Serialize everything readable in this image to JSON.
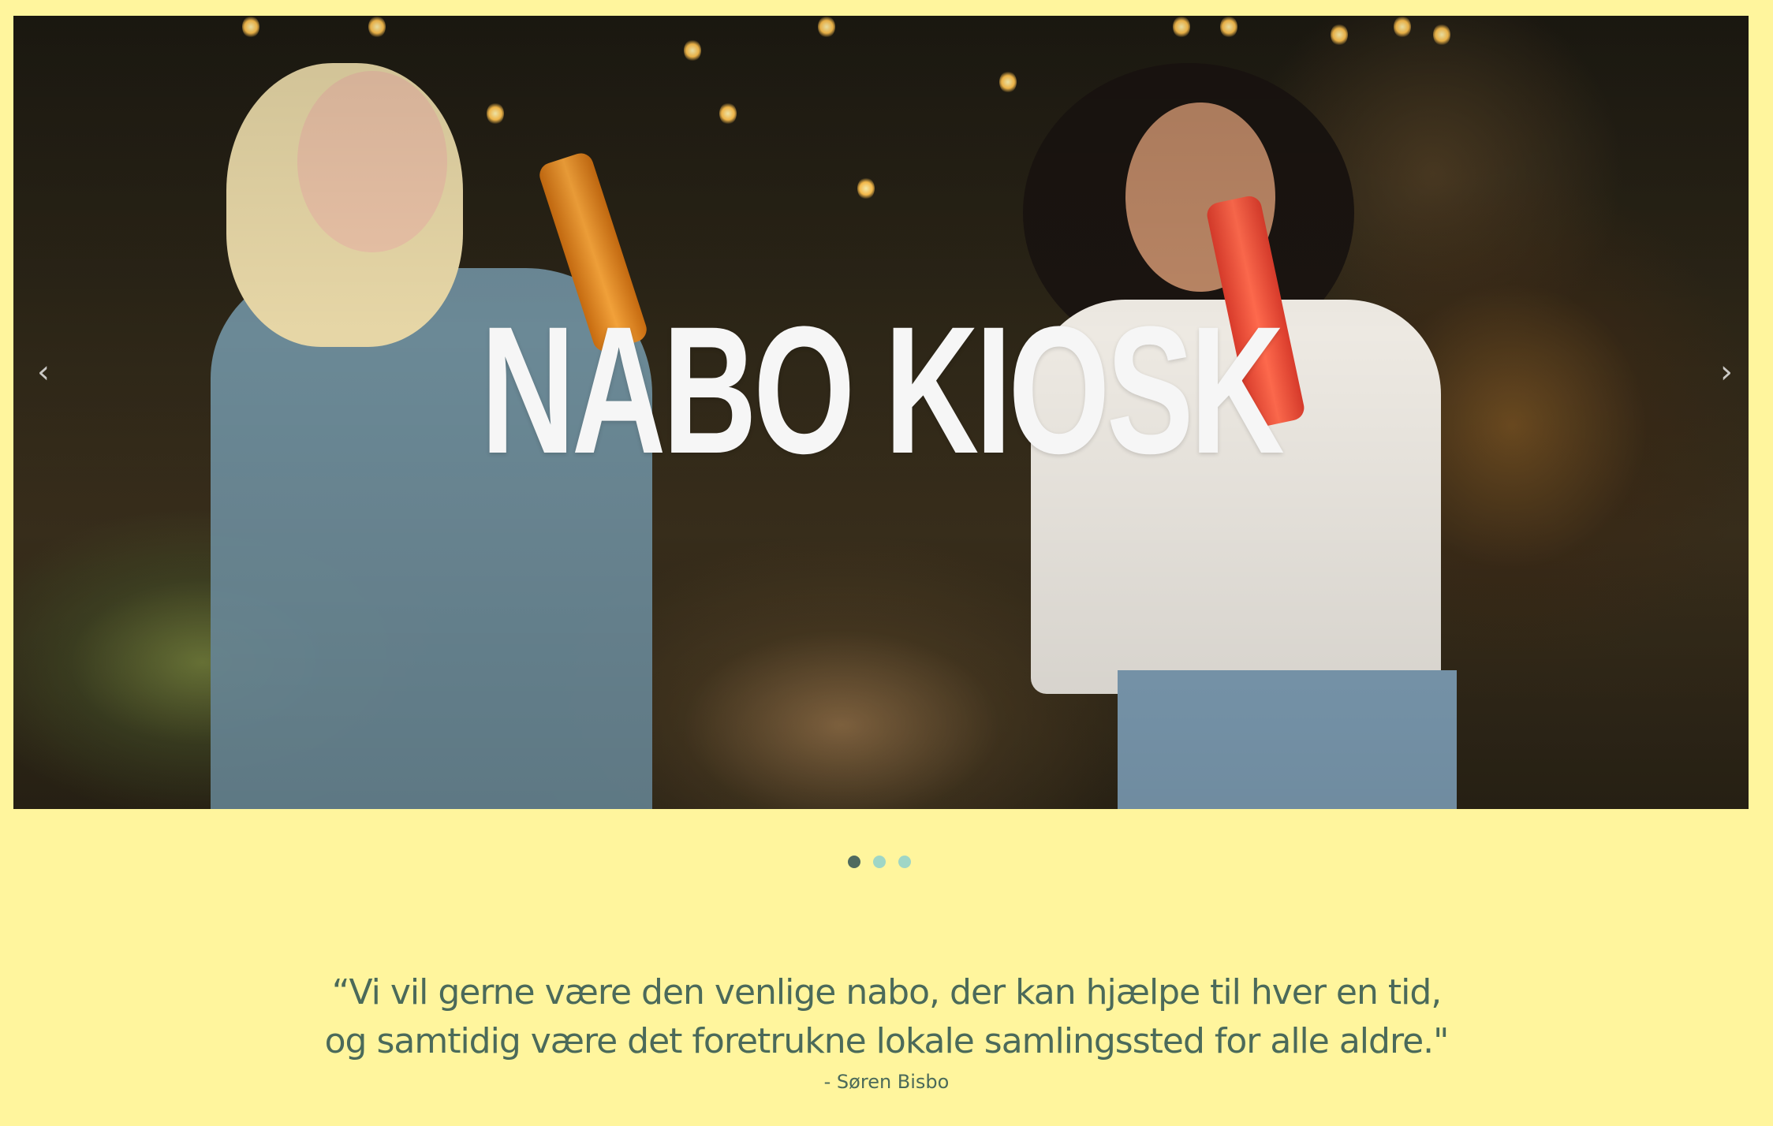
{
  "hero": {
    "title": "NABO KIOSK",
    "prev_label": "‹",
    "next_label": "›"
  },
  "carousel": {
    "slide_count": 3,
    "active_index": 0
  },
  "quote": {
    "line1": "“Vi vil gerne være den venlige nabo, der kan hjælpe til hver en tid,",
    "line2": "og samtidig være det foretrukne lokale samlingssted for alle aldre.\"",
    "attribution": "- Søren Bisbo"
  },
  "colors": {
    "background": "#fff59d",
    "text": "#4b6a5a",
    "dot_active": "#4f6a5f",
    "dot_inactive": "#9fd6c6"
  }
}
